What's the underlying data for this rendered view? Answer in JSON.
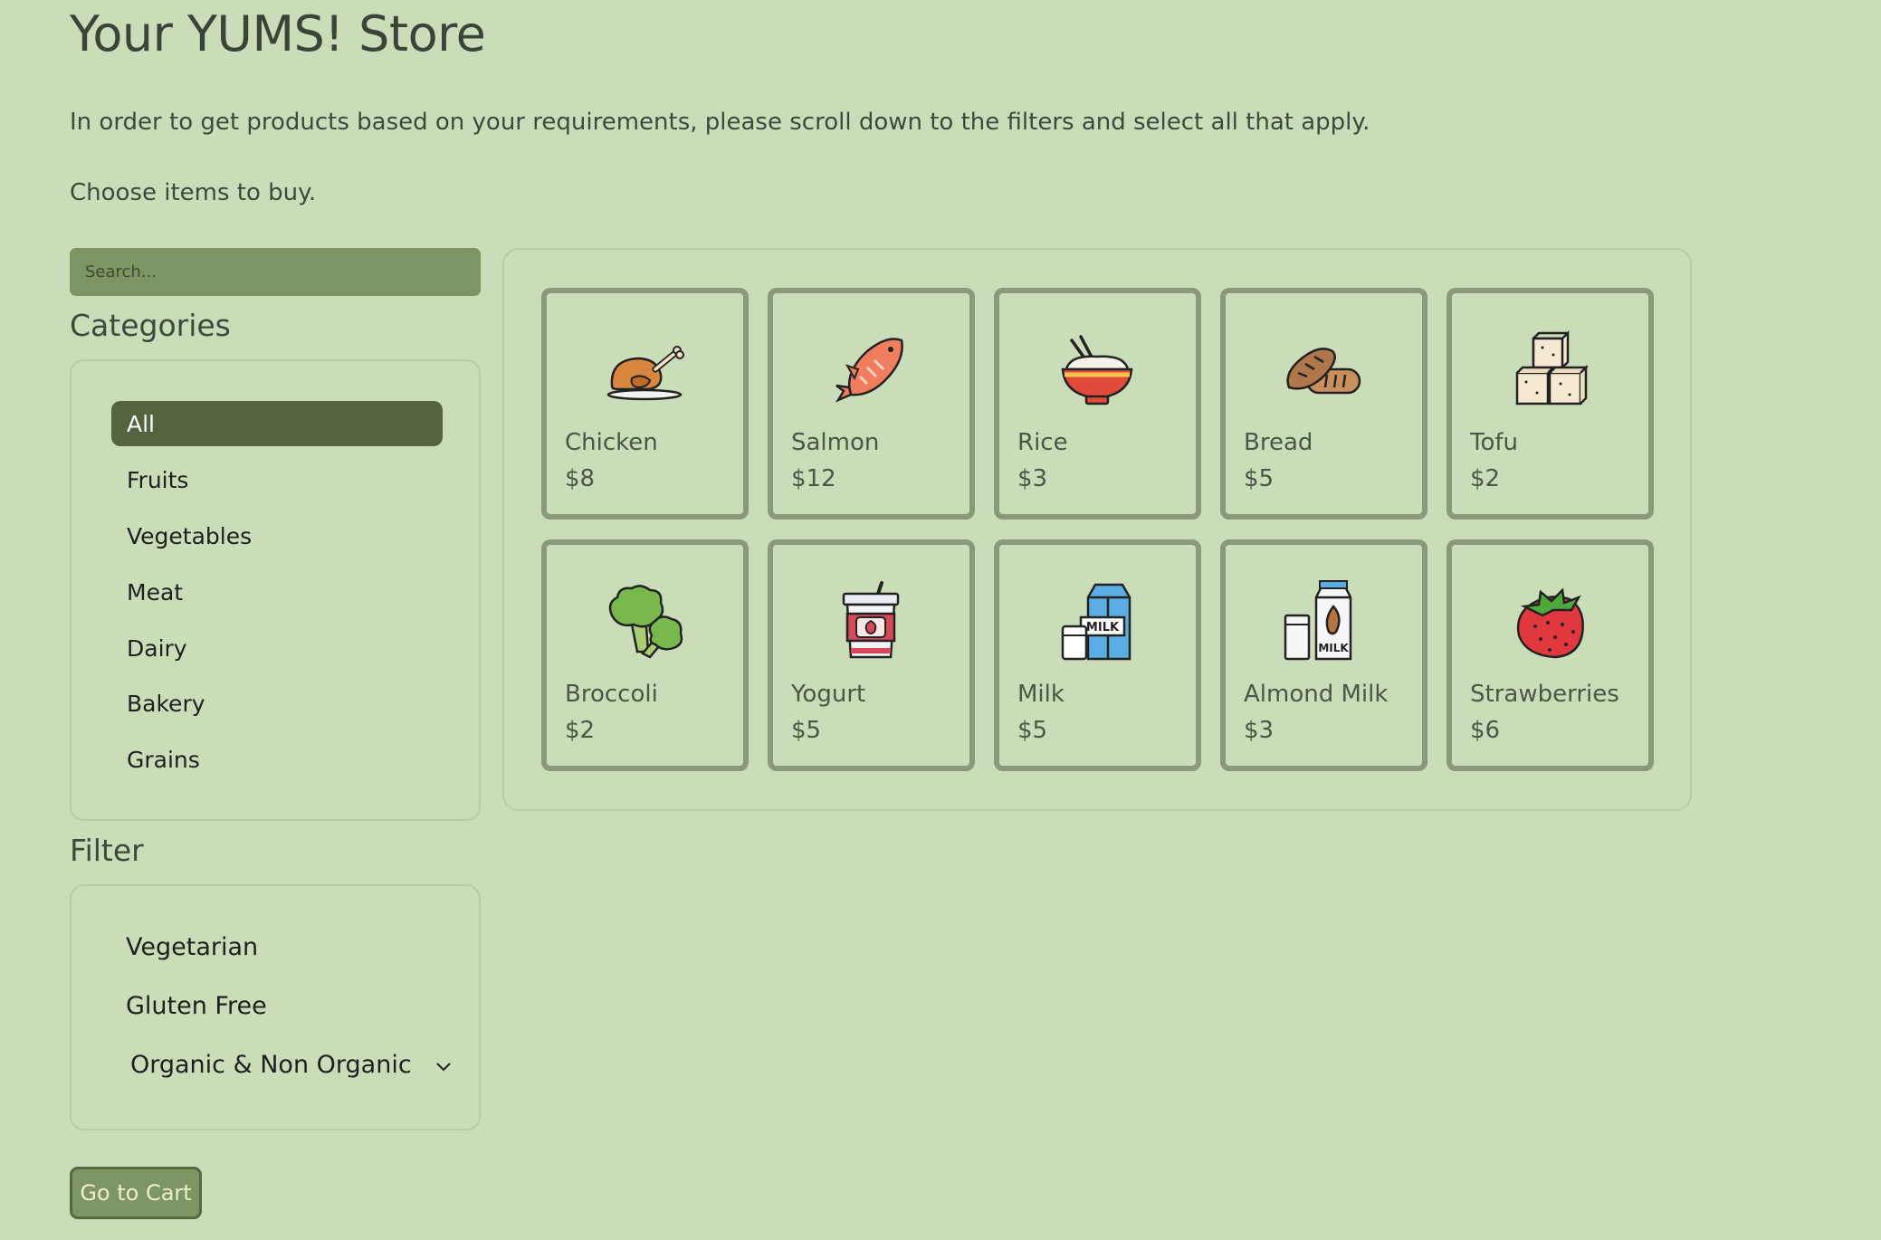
{
  "header": {
    "title": "Your YUMS! Store",
    "intro": "In order to get products based on your requirements, please scroll down to the filters and select all that apply.",
    "choose": "Choose items to buy."
  },
  "search": {
    "placeholder": "Search..."
  },
  "categories": {
    "heading": "Categories",
    "items": [
      {
        "label": "All",
        "active": true
      },
      {
        "label": "Fruits"
      },
      {
        "label": "Vegetables"
      },
      {
        "label": "Meat"
      },
      {
        "label": "Dairy"
      },
      {
        "label": "Bakery"
      },
      {
        "label": "Grains"
      }
    ]
  },
  "filter": {
    "heading": "Filter",
    "items": [
      {
        "label": "Vegetarian"
      },
      {
        "label": "Gluten Free"
      }
    ],
    "select": {
      "selected": "Organic & Non Organic",
      "icon": "chevron-down-icon"
    }
  },
  "cart": {
    "label": "Go to Cart"
  },
  "products": [
    {
      "name": "Chicken",
      "price": "$8",
      "icon": "chicken-icon"
    },
    {
      "name": "Salmon",
      "price": "$12",
      "icon": "salmon-icon"
    },
    {
      "name": "Rice",
      "price": "$3",
      "icon": "rice-bowl-icon"
    },
    {
      "name": "Bread",
      "price": "$5",
      "icon": "bread-icon"
    },
    {
      "name": "Tofu",
      "price": "$2",
      "icon": "tofu-icon"
    },
    {
      "name": "Broccoli",
      "price": "$2",
      "icon": "broccoli-icon"
    },
    {
      "name": "Yogurt",
      "price": "$5",
      "icon": "yogurt-icon"
    },
    {
      "name": "Milk",
      "price": "$5",
      "icon": "milk-carton-icon"
    },
    {
      "name": "Almond Milk",
      "price": "$3",
      "icon": "almond-milk-icon"
    },
    {
      "name": "Strawberries",
      "price": "$6",
      "icon": "strawberry-icon"
    }
  ],
  "colors": {
    "background": "#cbddb8",
    "accent": "#7d9563",
    "active_category": "#53643f",
    "card_border": "#89997a"
  }
}
